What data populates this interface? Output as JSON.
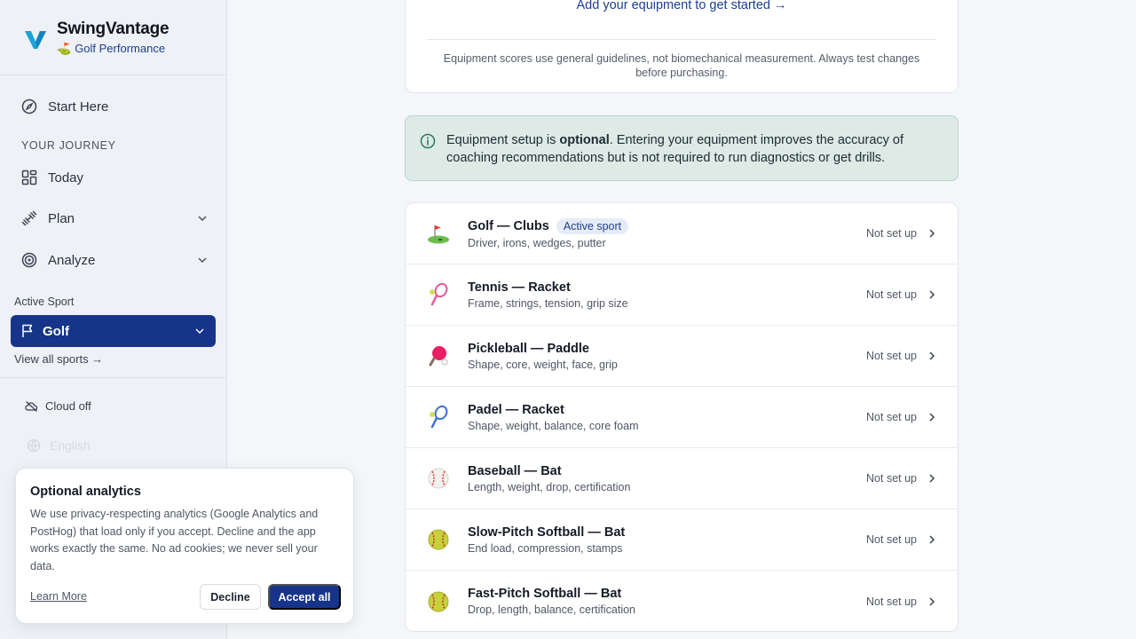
{
  "brand": {
    "name": "SwingVantage",
    "subtitle": "Golf Performance",
    "subtitle_emoji": "⛳"
  },
  "sidebar": {
    "start_here": "Start Here",
    "journey_label": "YOUR JOURNEY",
    "items": [
      {
        "label": "Today",
        "icon": "dashboard-icon"
      },
      {
        "label": "Plan",
        "icon": "dumbbell-icon"
      },
      {
        "label": "Analyze",
        "icon": "target-icon"
      }
    ],
    "active_sport_label": "Active Sport",
    "active_sport": "Golf",
    "view_all": "View all sports →",
    "cloud": "Cloud off",
    "language": "English"
  },
  "main": {
    "add_equipment": "Add your equipment to get started →",
    "disclaimer": "Equipment scores use general guidelines, not biomechanical measurement. Always test changes before purchasing.",
    "notice": {
      "before": "Equipment setup is ",
      "bold": "optional",
      "after": ". Entering your equipment improves the accuracy of coaching recommendations but is not required to run diagnostics or get drills."
    },
    "equipment": [
      {
        "emoji": "⛳",
        "title": "Golf — Clubs",
        "badge": "Active sport",
        "sub": "Driver, irons, wedges, putter",
        "status": "Not set up"
      },
      {
        "emoji": "🎾",
        "title": "Tennis — Racket",
        "badge": "",
        "sub": "Frame, strings, tension, grip size",
        "status": "Not set up"
      },
      {
        "emoji": "🏓",
        "title": "Pickleball — Paddle",
        "badge": "",
        "sub": "Shape, core, weight, face, grip",
        "status": "Not set up"
      },
      {
        "emoji": "🎾",
        "title": "Padel — Racket",
        "badge": "",
        "sub": "Shape, weight, balance, core foam",
        "status": "Not set up"
      },
      {
        "emoji": "⚾",
        "title": "Baseball — Bat",
        "badge": "",
        "sub": "Length, weight, drop, certification",
        "status": "Not set up"
      },
      {
        "emoji": "🥎",
        "title": "Slow-Pitch Softball — Bat",
        "badge": "",
        "sub": "End load, compression, stamps",
        "status": "Not set up"
      },
      {
        "emoji": "🥎",
        "title": "Fast-Pitch Softball — Bat",
        "badge": "",
        "sub": "Drop, length, balance, certification",
        "status": "Not set up"
      }
    ]
  },
  "cookie": {
    "title": "Optional analytics",
    "text": "We use privacy-respecting analytics (Google Analytics and PostHog) that load only if you accept. Decline and the app works exactly the same. No ad cookies; we never sell your data.",
    "learn_more": "Learn More",
    "decline": "Decline",
    "accept": "Accept all"
  },
  "colors": {
    "primary": "#15348a",
    "notice_bg": "#ddeae6",
    "logo": "#1aa3d9"
  }
}
